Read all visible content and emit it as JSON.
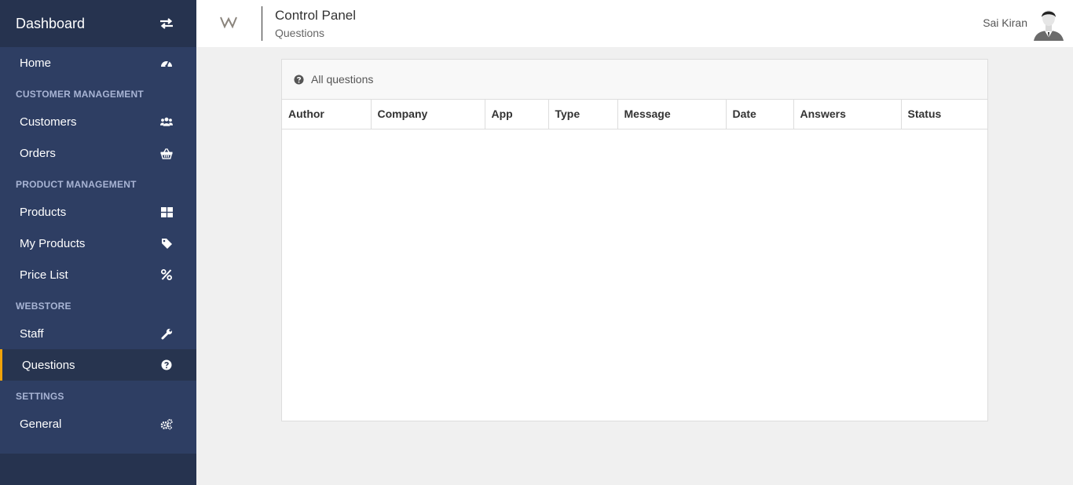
{
  "sidebar": {
    "title": "Dashboard",
    "toggle_icon": "exchange-icon",
    "menu": [
      {
        "type": "item",
        "label": "Home",
        "icon": "dashboard-icon"
      },
      {
        "type": "section",
        "label": "CUSTOMER MANAGEMENT"
      },
      {
        "type": "item",
        "label": "Customers",
        "icon": "users-icon"
      },
      {
        "type": "item",
        "label": "Orders",
        "icon": "basket-icon"
      },
      {
        "type": "section",
        "label": "PRODUCT MANAGEMENT"
      },
      {
        "type": "item",
        "label": "Products",
        "icon": "grid-icon"
      },
      {
        "type": "item",
        "label": "My Products",
        "icon": "tag-icon"
      },
      {
        "type": "item",
        "label": "Price List",
        "icon": "percent-icon"
      },
      {
        "type": "section",
        "label": "WEBSTORE"
      },
      {
        "type": "item",
        "label": "Staff",
        "icon": "wrench-icon"
      },
      {
        "type": "item",
        "label": "Questions",
        "icon": "question-circle-icon",
        "active": true
      },
      {
        "type": "section",
        "label": "SETTINGS"
      },
      {
        "type": "item",
        "label": "General",
        "icon": "gears-icon"
      }
    ]
  },
  "topbar": {
    "logo": "W",
    "title": "Control Panel",
    "subtitle": "Questions",
    "user_name": "Sai Kiran"
  },
  "panel": {
    "heading": "All questions",
    "columns": [
      "Author",
      "Company",
      "App",
      "Type",
      "Message",
      "Date",
      "Answers",
      "Status"
    ],
    "rows": []
  },
  "colors": {
    "sidebar_bg": "#2e3e63",
    "sidebar_header_bg": "#26334f",
    "active_accent": "#f0a30a",
    "section_label": "#a8b4d4"
  }
}
